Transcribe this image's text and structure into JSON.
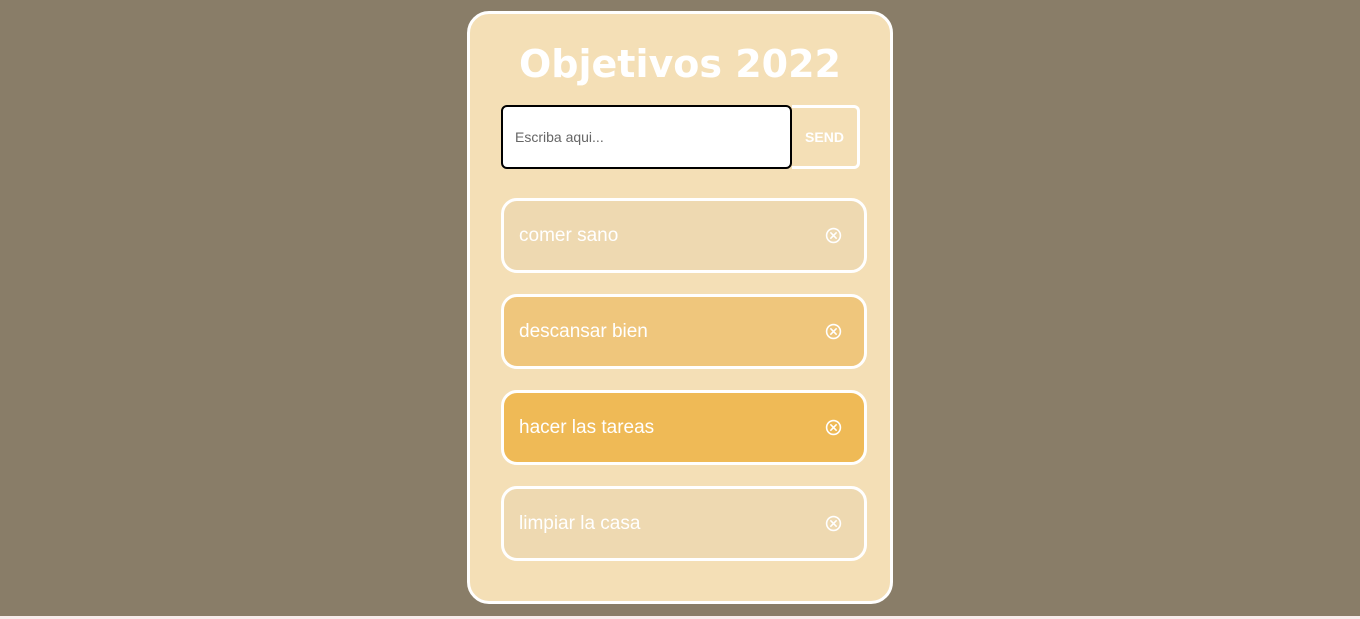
{
  "app": {
    "title": "Objetivos 2022"
  },
  "form": {
    "placeholder": "Escriba aqui...",
    "value": "",
    "send_label": "SEND"
  },
  "todos": [
    {
      "text": "comer sano",
      "color": "#eed9b1",
      "icon": "circle-x-icon"
    },
    {
      "text": "descansar bien",
      "color": "#efc67c",
      "icon": "circle-x-icon"
    },
    {
      "text": "hacer las tareas",
      "color": "#efba56",
      "icon": "circle-x-icon"
    },
    {
      "text": "limpiar la casa",
      "color": "#eed9b1",
      "icon": "circle-x-icon"
    }
  ],
  "colors": {
    "page_background": "#897d68",
    "card_background": "#f4dfb6",
    "border": "#ffffff",
    "text": "#ffffff"
  }
}
